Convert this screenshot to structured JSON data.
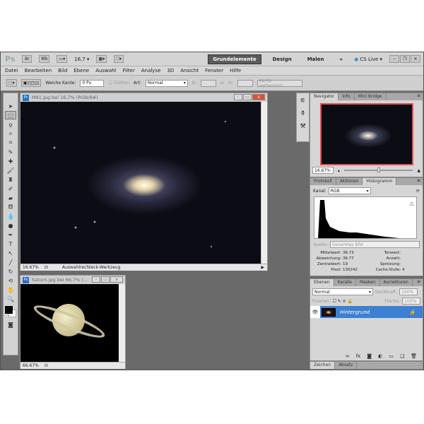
{
  "app": {
    "logo": "Ps",
    "zoom": "16,7",
    "workspaces": [
      "Grundelemente",
      "Design",
      "Malen"
    ],
    "more": "»",
    "cs_live": "CS Live ▾"
  },
  "menu": [
    "Datei",
    "Bearbeiten",
    "Bild",
    "Ebene",
    "Auswahl",
    "Filter",
    "Analyse",
    "3D",
    "Ansicht",
    "Fenster",
    "Hilfe"
  ],
  "options": {
    "feather_label": "Weiche Kante:",
    "feather_value": "0 Px",
    "antialias": "Glätten",
    "style_label": "Art:",
    "style_value": "Normal",
    "width_label": "B:",
    "height_label": "H:",
    "refine_button": "Kante verbessern..."
  },
  "documents": [
    {
      "title": "M81.jpg bei 16,7% (RGB/8#)",
      "zoom": "16.67%",
      "status": "Auswahlrechteck-Werkzeug"
    },
    {
      "title": "Saturn.jpg bei 66,7% (…",
      "zoom": "66.67%"
    }
  ],
  "navigator": {
    "tabs": [
      "Navigator",
      "Info",
      "Mini Bridge"
    ],
    "zoom": "16.67%",
    "highlight": "#e05050"
  },
  "histogram": {
    "tabs": [
      "Protokoll",
      "Aktionen",
      "Histogramm"
    ],
    "channel_label": "Kanal:",
    "channel": "RGB",
    "source_label": "Quelle:",
    "source": "Gesamtes Bild",
    "stats": [
      [
        "Mittelwert:",
        "36.73",
        "Tonwert:",
        ""
      ],
      [
        "Abweichung:",
        "36.77",
        "Anzahl:",
        ""
      ],
      [
        "Zentralwert:",
        "19",
        "Spreizung:",
        ""
      ],
      [
        "Pixel:",
        "130242",
        "Cache-Stufe:",
        "4"
      ]
    ]
  },
  "layers": {
    "tabs": [
      "Ebenen",
      "Kanäle",
      "Masken",
      "Korrekturen"
    ],
    "blend": "Normal",
    "opacity_label": "Deckkraft:",
    "opacity": "100%",
    "lock_label": "Fixieren:",
    "fill_label": "Fläche:",
    "fill": "100%",
    "items": [
      {
        "name": "Hintergrund",
        "selected": true
      }
    ],
    "accent": "#3d7fd0"
  },
  "bottom_tabs": [
    "Zeichen",
    "Absatz"
  ]
}
